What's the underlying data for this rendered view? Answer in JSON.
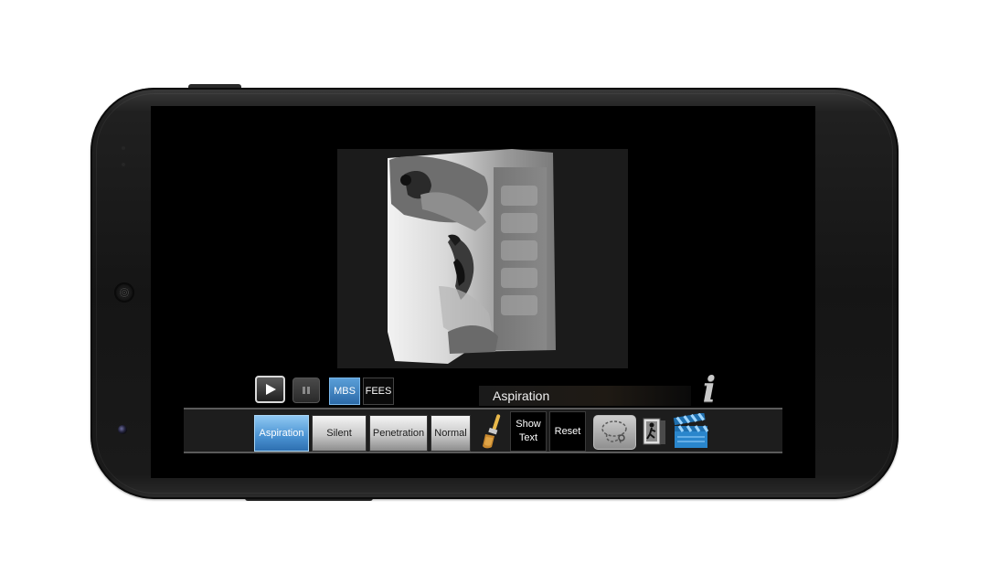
{
  "player": {
    "play_icon": "play-icon",
    "pause_icon": "pause-icon",
    "mode_mbs": "MBS",
    "mode_fees": "FEES",
    "selected_mode": "MBS"
  },
  "caption": {
    "text": "Aspiration"
  },
  "info_icon_glyph": "i",
  "toolbar": {
    "tabs": [
      {
        "label": "Aspiration",
        "active": true
      },
      {
        "label": "Silent",
        "active": false
      },
      {
        "label": "Penetration",
        "active": false
      },
      {
        "label": "Normal",
        "active": false
      }
    ],
    "brush_icon": "paintbrush-icon",
    "show_text_line1": "Show",
    "show_text_line2": "Text",
    "reset_label": "Reset",
    "lasso_icon": "lasso-icon",
    "exit_icon": "exit-door-icon",
    "clapper_icon": "clapperboard-icon"
  },
  "colors": {
    "accent_blue": "#4a92d2",
    "screen_bg": "#000000"
  }
}
